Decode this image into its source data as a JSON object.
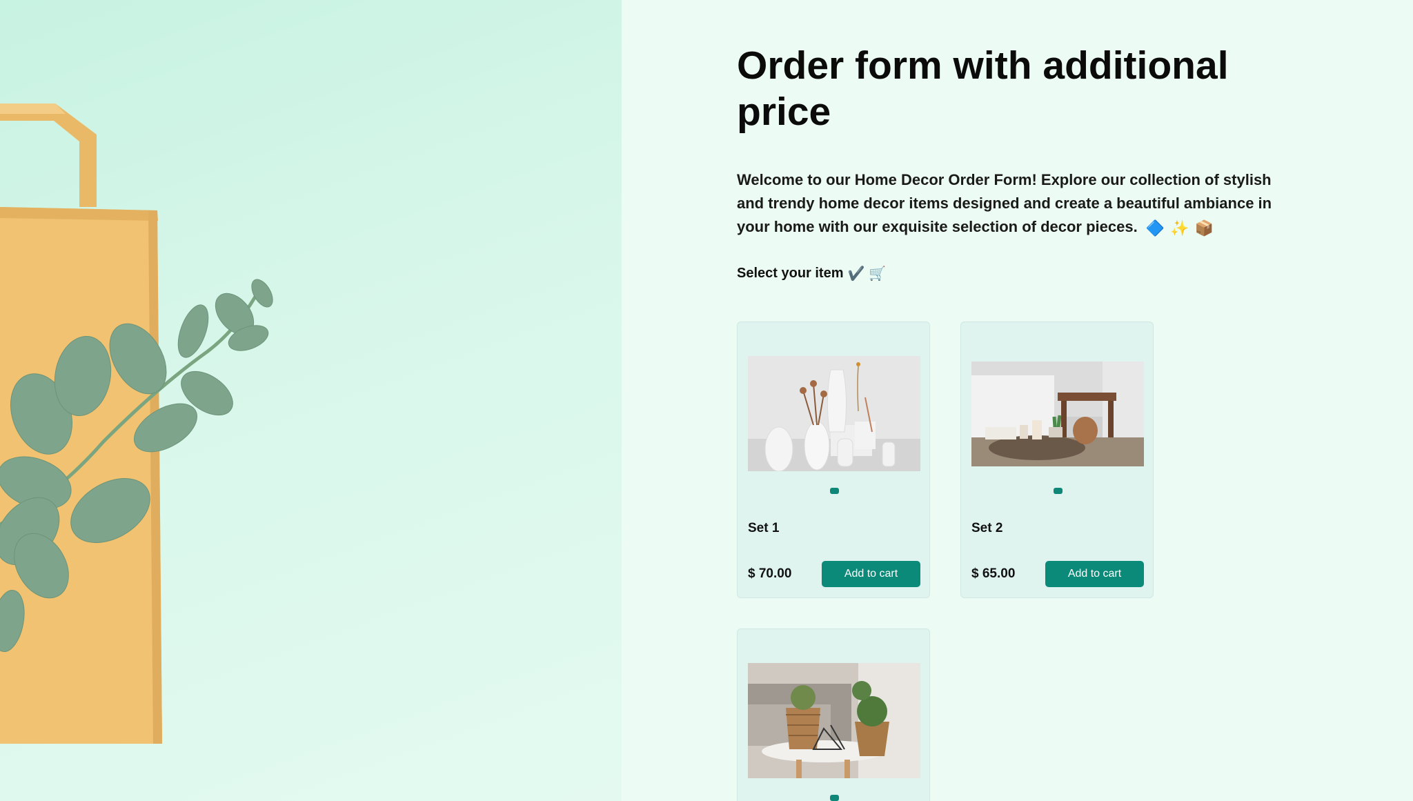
{
  "form": {
    "title": "Order form with additional price",
    "intro": "Welcome to our Home Decor Order Form! Explore our collection of stylish and trendy home decor items designed and create a beautiful ambiance in your home with our exquisite selection of decor pieces.",
    "intro_emojis": [
      "🔷",
      "✨",
      "📦"
    ],
    "select_label": "Select your item",
    "select_emojis": [
      "✔️",
      "🛒"
    ]
  },
  "products": [
    {
      "name": "Set 1",
      "price": "$ 70.00",
      "button": "Add to cart",
      "image": "white-vases-with-dried-flowers"
    },
    {
      "name": "Set 2",
      "price": "$ 65.00",
      "button": "Add to cart",
      "image": "bedroom-tray-with-candles-and-diffuser"
    },
    {
      "name": "",
      "price": "",
      "button": "",
      "image": "wicker-planters-on-side-table"
    }
  ],
  "colors": {
    "accent": "#0c8a79",
    "page_bg": "#ecfbf3",
    "card_bg": "#dff4ef",
    "hero_bg": "#cff4e5",
    "paper_bag": "#f0c271"
  }
}
